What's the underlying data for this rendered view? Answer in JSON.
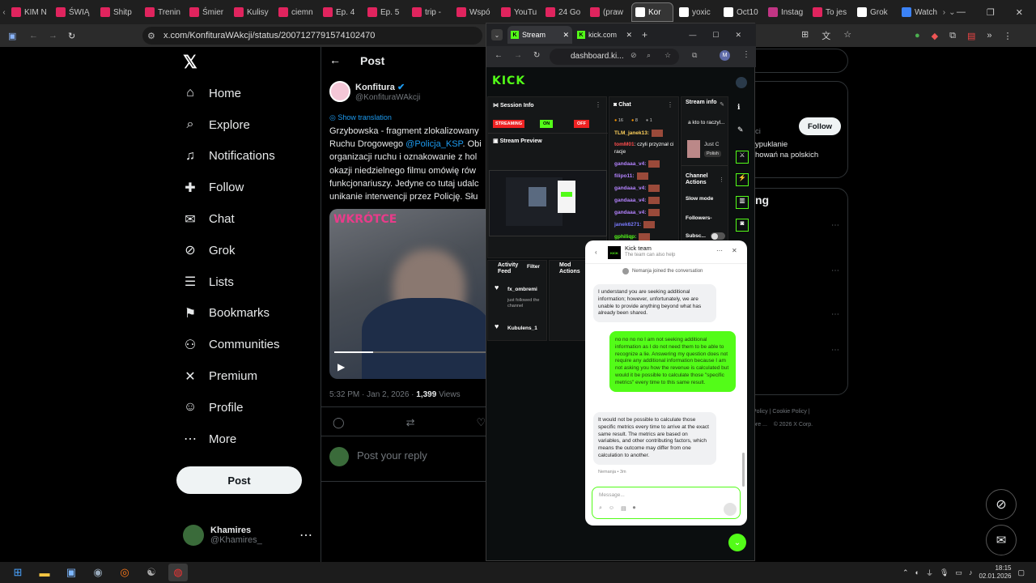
{
  "browser": {
    "tabs": [
      {
        "label": "KIM N",
        "color": "#e0245e"
      },
      {
        "label": "ŚWIĄ",
        "color": "#e0245e"
      },
      {
        "label": "Shitp",
        "color": "#e0245e"
      },
      {
        "label": "Trenin",
        "color": "#e0245e"
      },
      {
        "label": "Śmier",
        "color": "#e0245e"
      },
      {
        "label": "Kulisy",
        "color": "#e0245e"
      },
      {
        "label": "ciemn",
        "color": "#e0245e"
      },
      {
        "label": "Ep. 4",
        "color": "#e0245e"
      },
      {
        "label": "Ep. 5",
        "color": "#e0245e"
      },
      {
        "label": "trip -",
        "color": "#e0245e"
      },
      {
        "label": "Wspó",
        "color": "#e0245e"
      },
      {
        "label": "YouTu",
        "color": "#e0245e"
      },
      {
        "label": "24 Go",
        "color": "#e0245e"
      },
      {
        "label": "(praw",
        "color": "#e0245e"
      },
      {
        "label": "Kor",
        "color": "#ffffff"
      },
      {
        "label": "yoxic",
        "color": "#ffffff"
      },
      {
        "label": "Oct10",
        "color": "#ffffff"
      },
      {
        "label": "Instag",
        "color": "#c13584"
      },
      {
        "label": "To jes",
        "color": "#e0245e"
      },
      {
        "label": "Grok",
        "color": "#ffffff"
      },
      {
        "label": "Watch",
        "color": "#3b82f6"
      }
    ],
    "url": "x.com/KonfituraWAkcji/status/2007127791574102470"
  },
  "nav": {
    "items": [
      {
        "label": "Home",
        "icon": "⌂"
      },
      {
        "label": "Explore",
        "icon": "⌕"
      },
      {
        "label": "Notifications",
        "icon": "♫"
      },
      {
        "label": "Follow",
        "icon": "✚"
      },
      {
        "label": "Chat",
        "icon": "✉"
      },
      {
        "label": "Grok",
        "icon": "⊘"
      },
      {
        "label": "Lists",
        "icon": "☰"
      },
      {
        "label": "Bookmarks",
        "icon": "⚑"
      },
      {
        "label": "Communities",
        "icon": "⚇"
      },
      {
        "label": "Premium",
        "icon": "✕"
      },
      {
        "label": "Profile",
        "icon": "☺"
      },
      {
        "label": "More",
        "icon": "⋯"
      }
    ],
    "post_label": "Post",
    "user_name": "Khamires",
    "user_handle": "@Khamires_"
  },
  "post": {
    "header": "Post",
    "author_name": "Konfitura",
    "author_handle": "@KonfituraWAkcji",
    "show_translation": "Show translation",
    "text_lines": [
      "Grzybowska - fragment zlokalizowany",
      "Ruchu Drogowego ",
      "organizacji ruchu i oznakowanie z hol",
      "okazji niedzielnego filmu omówię rów",
      "funkcjonariuszy. Jedyne co tutaj udalc",
      "unikanie interwencji przez Policję. Słu"
    ],
    "mention": "@Policja_KSP",
    "mention_tail": ". Obi",
    "image_caption": "WKRÓTCE",
    "meta_time": "5:32 PM · Jan 2, 2026 · ",
    "meta_views_count": "1,399",
    "meta_views_label": " Views",
    "reply_placeholder": "Post your reply"
  },
  "right": {
    "follow_label": "Follow",
    "snippet1": "ci",
    "snippet2": "ypuklanie",
    "snippet3": "howań na polskich",
    "snippet4": "ng",
    "footer1": "Policy",
    "footer2": "Cookie Policy",
    "footer3": "ore ...",
    "footer4": "© 2026 X Corp."
  },
  "kick": {
    "tab1": "Stream",
    "tab2": "kick.com",
    "url": "dashboard.ki...",
    "logo": "KICK",
    "session_info": "Session Info",
    "streaming": "STREAMING",
    "on": "ON",
    "off": "OFF",
    "stream_preview": "Stream Preview",
    "chat_title": "Chat",
    "chat_counts": [
      "16",
      "8",
      "1"
    ],
    "chat_msgs": [
      {
        "user": "TLM_janek13:",
        "text": "",
        "color": "#ffd15c"
      },
      {
        "user": "tomM01",
        "text": ": czyli przyznał ci racje",
        "color": "#ff4d4d"
      },
      {
        "user": "gandaaa_v4:",
        "text": "",
        "color": "#b483ff"
      },
      {
        "user": "filipo11:",
        "text": "",
        "color": "#b483ff"
      },
      {
        "user": "gandaaa_v4:",
        "text": "",
        "color": "#b483ff"
      },
      {
        "user": "gandaaa_v4:",
        "text": "",
        "color": "#b483ff"
      },
      {
        "user": "gandaaa_v4:",
        "text": "",
        "color": "#b483ff"
      },
      {
        "user": "janek6271:",
        "text": "",
        "color": "#7a7aff"
      },
      {
        "user": "gphiliqp:",
        "text": "",
        "color": "#53fc18"
      }
    ],
    "stream_info": "Stream info",
    "stream_title": "a kto to raczyl...",
    "game": "Just C",
    "lang": "Polish",
    "channel_actions": "Channel Actions",
    "slow_mode": "Slow mode",
    "followers": "Followers-",
    "subs": "Subsc...",
    "activity_feed": "Activity Feed",
    "filter": "Filter",
    "mod_actions": "Mod Actions",
    "activity": [
      {
        "user": "fx_ombremi",
        "text": "just followed the channel"
      },
      {
        "user": "Kubulens_1",
        "text": ""
      }
    ]
  },
  "support": {
    "title": "Kick team",
    "subtitle": "The team can also help",
    "joined": "Nemanja joined the conversation",
    "msg1": "I understand you are seeking additional information; however, unfortunately, we are unable to provide anything beyond what has already been shared.",
    "msg2": "no no no no I am not seeking additional information as I do not need them to be able to recognize a lie. Answering my question does not require any additional information because I am not asking you how the revenue is calculated but would it be possible to calculate those \"specific metrics\" every time to this same result.",
    "msg3": "It would not be possible to calculate those specific metrics every time to arrive at the exact same result. The metrics are based on variables, and other contributing factors, which means the outcome may differ from one calculation to another.",
    "msg3_meta": "Nemanja • 3m",
    "input_placeholder": "Message..."
  },
  "taskbar": {
    "time": "18:15",
    "date": "02.01.2026"
  }
}
